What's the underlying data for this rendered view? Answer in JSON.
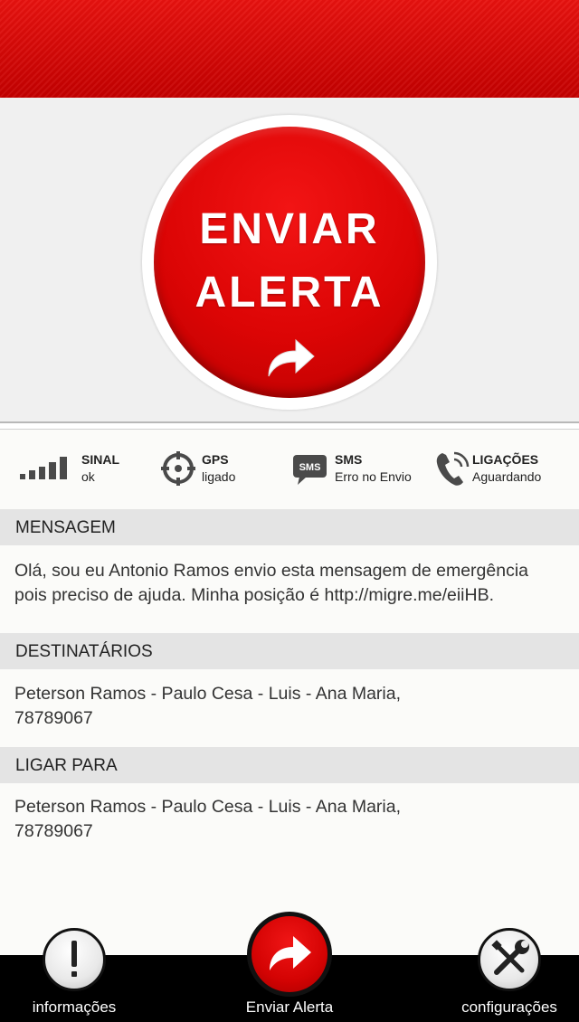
{
  "alert_button": {
    "line1": "ENVIAR",
    "line2": "ALERTA",
    "icon": "share-arrow-icon"
  },
  "status": [
    {
      "title": "SINAL",
      "sub": "ok",
      "icon": "signal-bars-icon"
    },
    {
      "title": "GPS",
      "sub": "ligado",
      "icon": "crosshair-icon"
    },
    {
      "title": "SMS",
      "sub": "Erro no Envio",
      "icon": "sms-bubble-icon",
      "icon_text": "SMS"
    },
    {
      "title": "LIGAÇÕES",
      "sub": "Aguardando",
      "icon": "phone-icon"
    }
  ],
  "sections": {
    "mensagem": {
      "title": "MENSAGEM",
      "lines": [
        "Olá, sou eu Antonio Ramos envio esta mensagem de emergência",
        "pois preciso de ajuda. Minha posição é http://migre.me/eiiHB."
      ]
    },
    "destinatarios": {
      "title": "DESTINATÁRIOS",
      "lines": [
        "Peterson Ramos - Paulo Cesa - Luis - Ana Maria,",
        "78789067"
      ]
    },
    "ligar_para": {
      "title": "LIGAR PARA",
      "lines": [
        "Peterson Ramos - Paulo Cesa - Luis - Ana Maria,",
        "78789067"
      ]
    }
  },
  "tabbar": {
    "info": {
      "label": "informações",
      "icon": "exclamation-icon",
      "glyph": "!"
    },
    "send": {
      "label": "Enviar Alerta",
      "icon": "share-arrow-icon"
    },
    "config": {
      "label": "configurações",
      "icon": "wrench-screwdriver-icon"
    }
  },
  "colors": {
    "accent": "#d90000",
    "header": "#e8120f",
    "tabbar": "#000000",
    "section_head": "#e4e4e4"
  }
}
